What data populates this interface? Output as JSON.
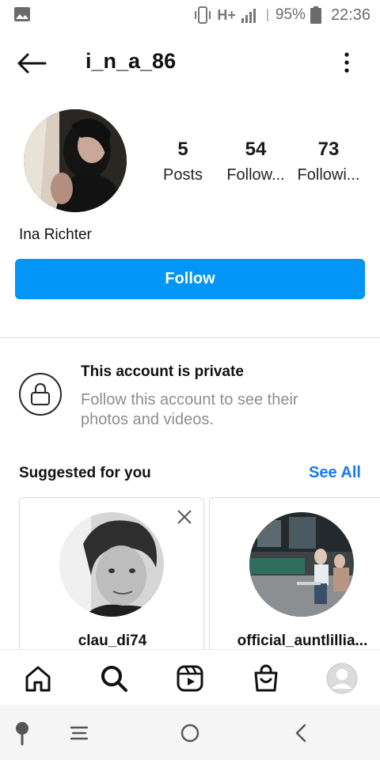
{
  "status_bar": {
    "network": "H+",
    "battery_percent": "95%",
    "time": "22:36"
  },
  "header": {
    "username": "i_n_a_86"
  },
  "profile": {
    "full_name": "Ina Richter",
    "stats": [
      {
        "value": "5",
        "label": "Posts"
      },
      {
        "value": "54",
        "label": "Follow..."
      },
      {
        "value": "73",
        "label": "Followi..."
      }
    ],
    "follow_label": "Follow"
  },
  "private_notice": {
    "title": "This account is private",
    "description": "Follow this account to see their photos and videos."
  },
  "suggested": {
    "title": "Suggested for you",
    "see_all": "See All",
    "cards": [
      {
        "username": "clau_di74"
      },
      {
        "username": "official_auntlillia..."
      }
    ]
  },
  "bottom_nav": {
    "items": [
      "home-icon",
      "search-icon",
      "reels-icon",
      "shop-icon",
      "profile-icon"
    ]
  },
  "system_nav": {
    "items": [
      "assistant-icon",
      "recents-icon",
      "home-circle-icon",
      "back-chevron-icon"
    ]
  },
  "colors": {
    "accent": "#0095f6",
    "link": "#1877f2",
    "muted_text": "#8e8e8e"
  }
}
